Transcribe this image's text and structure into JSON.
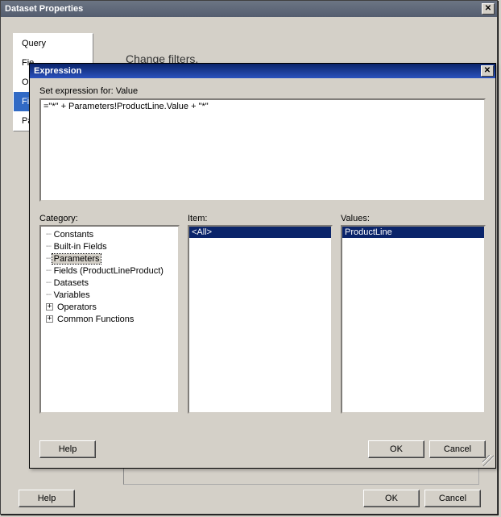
{
  "outer": {
    "title": "Dataset Properties",
    "close_glyph": "✕",
    "content_title": "Change filters.",
    "tabs": [
      {
        "label": "Query"
      },
      {
        "label": "Fie"
      },
      {
        "label": "Op"
      },
      {
        "label": "Fil"
      },
      {
        "label": "Pa"
      }
    ],
    "buttons": {
      "help": "Help",
      "ok": "OK",
      "cancel": "Cancel"
    }
  },
  "expr": {
    "title": "Expression",
    "close_glyph": "✕",
    "set_label": "Set expression for: Value",
    "expression_text": "=\"*\" + Parameters!ProductLine.Value + \"*\"",
    "col_labels": {
      "category": "Category:",
      "item": "Item:",
      "values": "Values:"
    },
    "categories": [
      {
        "label": "Constants",
        "expander": null
      },
      {
        "label": "Built-in Fields",
        "expander": null
      },
      {
        "label": "Parameters",
        "expander": null,
        "selected": true
      },
      {
        "label": "Fields (ProductLineProduct)",
        "expander": null
      },
      {
        "label": "Datasets",
        "expander": null
      },
      {
        "label": "Variables",
        "expander": null
      },
      {
        "label": "Operators",
        "expander": "+"
      },
      {
        "label": "Common Functions",
        "expander": "+"
      }
    ],
    "items": [
      {
        "label": "<All>",
        "selected": true
      }
    ],
    "values": [
      {
        "label": "ProductLine",
        "selected": true
      }
    ],
    "buttons": {
      "help": "Help",
      "ok": "OK",
      "cancel": "Cancel"
    }
  }
}
